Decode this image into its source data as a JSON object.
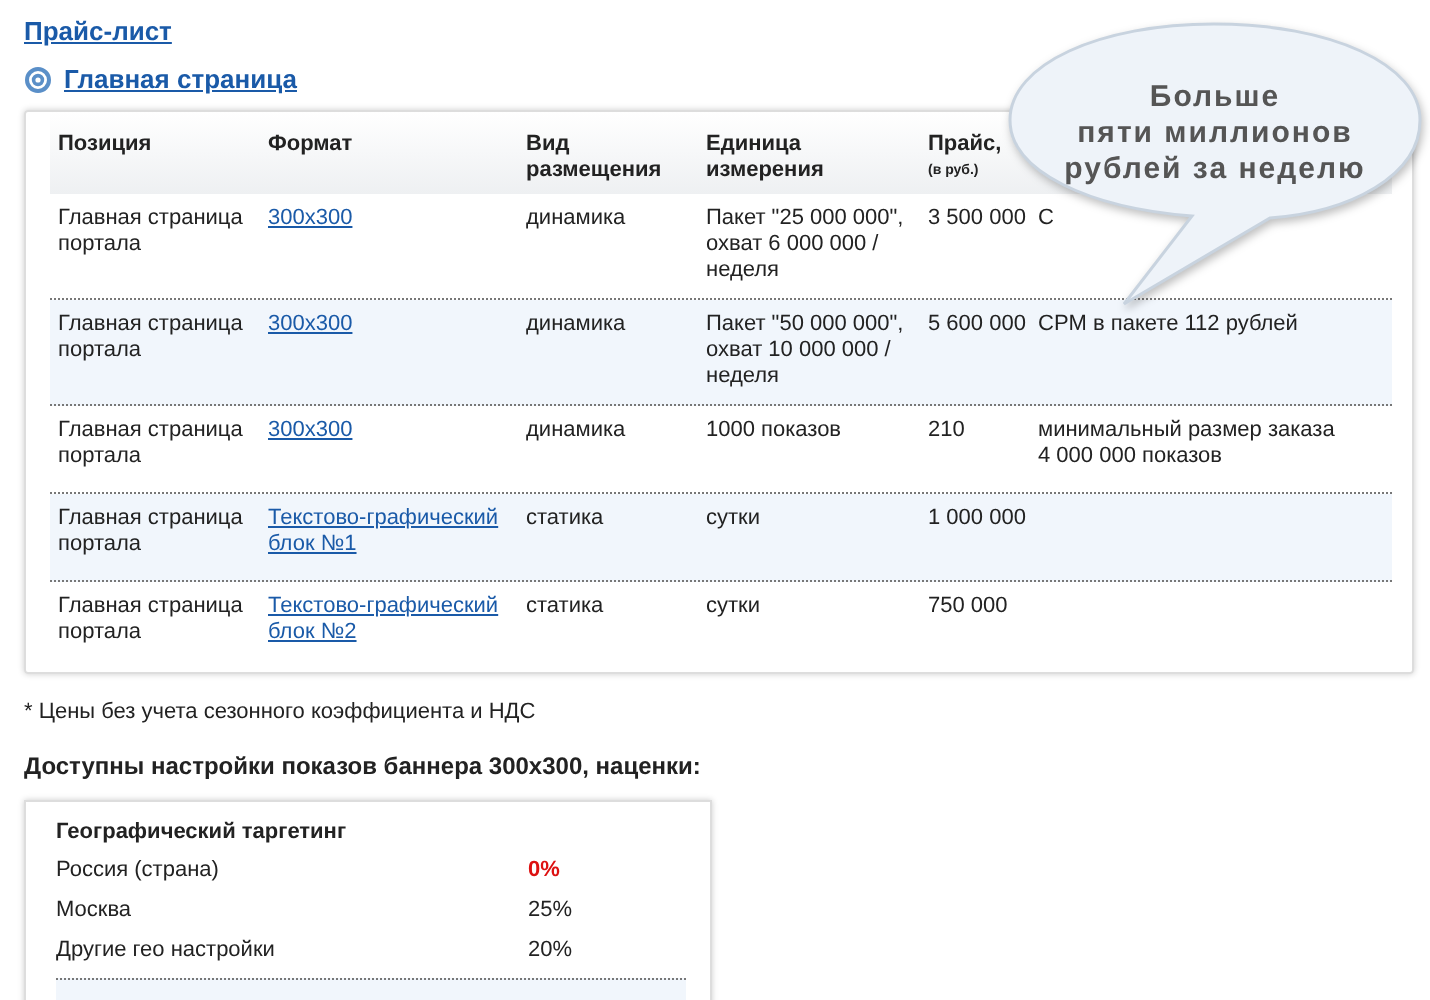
{
  "breadcrumb": "Прайс-лист",
  "section": {
    "title": "Главная страница"
  },
  "table": {
    "columns": [
      {
        "label": "Позиция"
      },
      {
        "label": "Формат"
      },
      {
        "label": "Вид размещения"
      },
      {
        "label": "Единица измерения"
      },
      {
        "label": "Прайс,",
        "sub": "(в руб.)"
      }
    ],
    "rows": [
      {
        "position": "Главная страница портала",
        "format": "300x300",
        "type": "динамика",
        "unit": "Пакет \"25 000 000\", охват 6 000 000 / неделя",
        "price": "3 500 000",
        "note": "С"
      },
      {
        "position": "Главная страница портала",
        "format": "300x300",
        "type": "динамика",
        "unit": "Пакет \"50 000 000\", охват 10 000 000 / неделя",
        "price": "5 600 000",
        "note": "CPM в пакете 112 рублей"
      },
      {
        "position": "Главная страница портала",
        "format": "300x300",
        "type": "динамика",
        "unit": "1000 показов",
        "price": "210",
        "note": "минимальный размер заказа 4 000 000 показов"
      },
      {
        "position": "Главная страница портала",
        "format": "Текстово-графический блок №1",
        "type": "статика",
        "unit": "сутки",
        "price": "1 000 000"
      },
      {
        "position": "Главная страница портала",
        "format": "Текстово-графический блок №2",
        "type": "статика",
        "unit": "сутки",
        "price": "750 000"
      }
    ]
  },
  "callout": {
    "lines": [
      "Больше",
      "пяти миллионов",
      "рублей за неделю"
    ]
  },
  "footnote": "* Цены без учета сезонного коэффициента и НДС",
  "settings_heading": "Доступны настройки показов баннера 300x300, наценки:",
  "geo": {
    "title": "Географический таргетинг",
    "rows": [
      {
        "name": "Россия (страна)",
        "value": "0%",
        "highlighted": true
      },
      {
        "name": "Москва",
        "value": "25%",
        "highlighted": false
      },
      {
        "name": "Другие гео настройки",
        "value": "20%",
        "highlighted": false
      }
    ]
  }
}
